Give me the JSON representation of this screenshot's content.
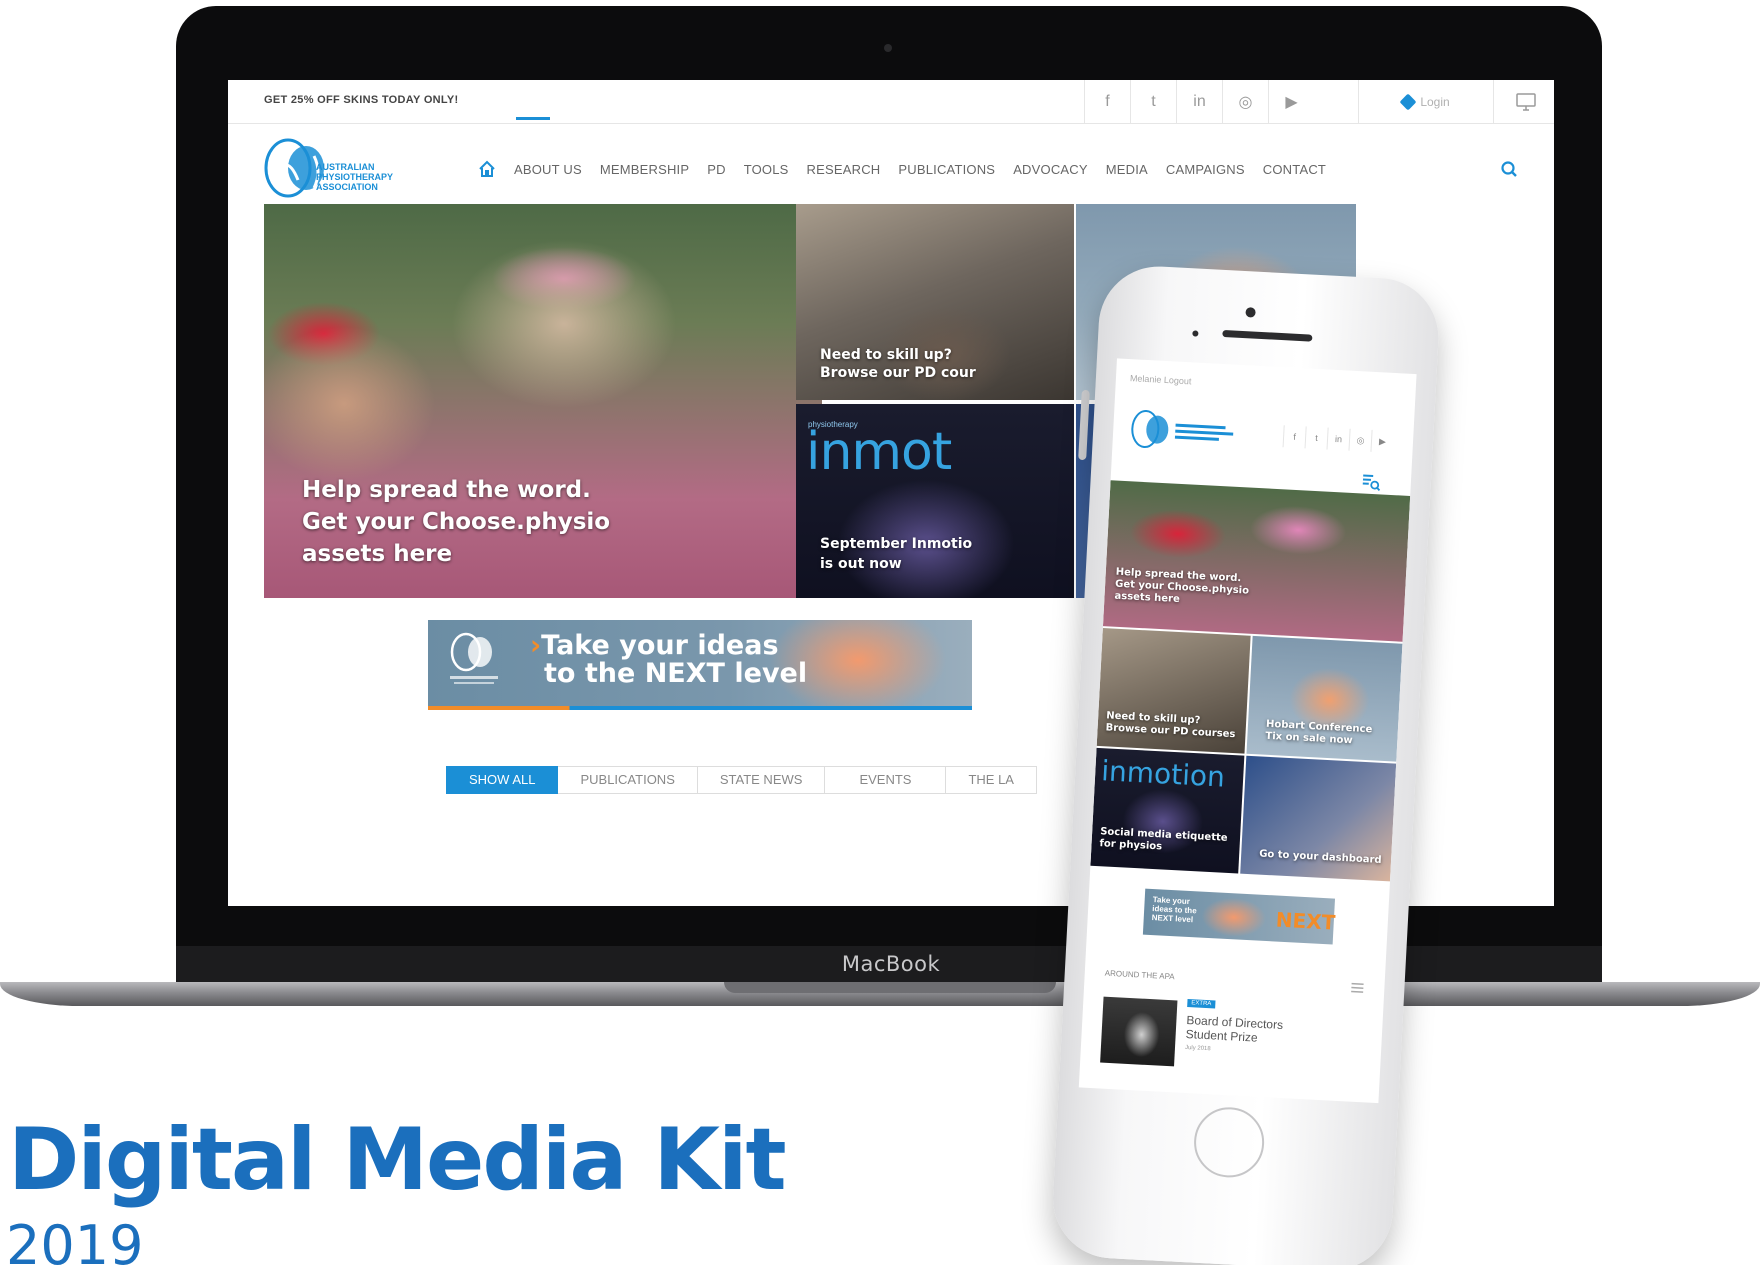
{
  "colors": {
    "brand_blue": "#1b8fd6",
    "title_blue": "#1b6fbd",
    "accent_orange": "#f28c28"
  },
  "laptop": {
    "brand": "MacBook"
  },
  "site": {
    "promo": "GET 25% OFF SKINS TODAY ONLY!",
    "social": [
      {
        "icon": "facebook-icon",
        "label": "f"
      },
      {
        "icon": "twitter-icon",
        "label": "t"
      },
      {
        "icon": "linkedin-icon",
        "label": "in"
      },
      {
        "icon": "instagram-icon",
        "label": "◎"
      },
      {
        "icon": "youtube-icon",
        "label": "▶"
      }
    ],
    "login_label": "Login",
    "logo": {
      "line1": "AUSTRALIAN",
      "line2": "PHYSIOTHERAPY",
      "line3": "ASSOCIATION"
    },
    "nav": [
      "ABOUT US",
      "MEMBERSHIP",
      "PD",
      "TOOLS",
      "RESEARCH",
      "PUBLICATIONS",
      "ADVOCACY",
      "MEDIA",
      "CAMPAIGNS",
      "CONTACT"
    ],
    "hero": {
      "line1": "Help spread the word.",
      "line2": "Get your Choose.physio",
      "line3": "assets here"
    },
    "tile_pd": {
      "line1": "Need to skill up?",
      "line2": "Browse our PD cour"
    },
    "tile_inmotion": {
      "brand_small": "physiotherapy",
      "brand": "inmot",
      "line1": "September Inmotio",
      "line2": "is out now"
    },
    "banner": {
      "line1": "Take your ideas",
      "line2": "to the NEXT level"
    },
    "filters": [
      "SHOW ALL",
      "PUBLICATIONS",
      "STATE NEWS",
      "EVENTS",
      "THE LA"
    ]
  },
  "mobile": {
    "status": "Melanie Logout",
    "hero": {
      "line1": "Help spread the word.",
      "line2": "Get your Choose.physio",
      "line3": "assets here"
    },
    "pd": {
      "line1": "Need to skill up?",
      "line2": "Browse our PD courses"
    },
    "hobart": {
      "line1": "Hobart Conference",
      "line2": "Tix on sale now"
    },
    "inmotion": {
      "brand": "inmotion",
      "line1": "Social media etiquette",
      "line2": "for physios"
    },
    "dashboard": "Go to your dashboard",
    "banner": {
      "line1": "Take your",
      "line2": "ideas to the",
      "line3": "NEXT level",
      "next": "NEXT"
    },
    "around": "AROUND THE APA",
    "article": {
      "badge": "EXTRA",
      "title": "Board of Directors Student Prize",
      "date": "July 2018"
    }
  },
  "kit": {
    "title": "Digital Media Kit",
    "year": "2019"
  }
}
